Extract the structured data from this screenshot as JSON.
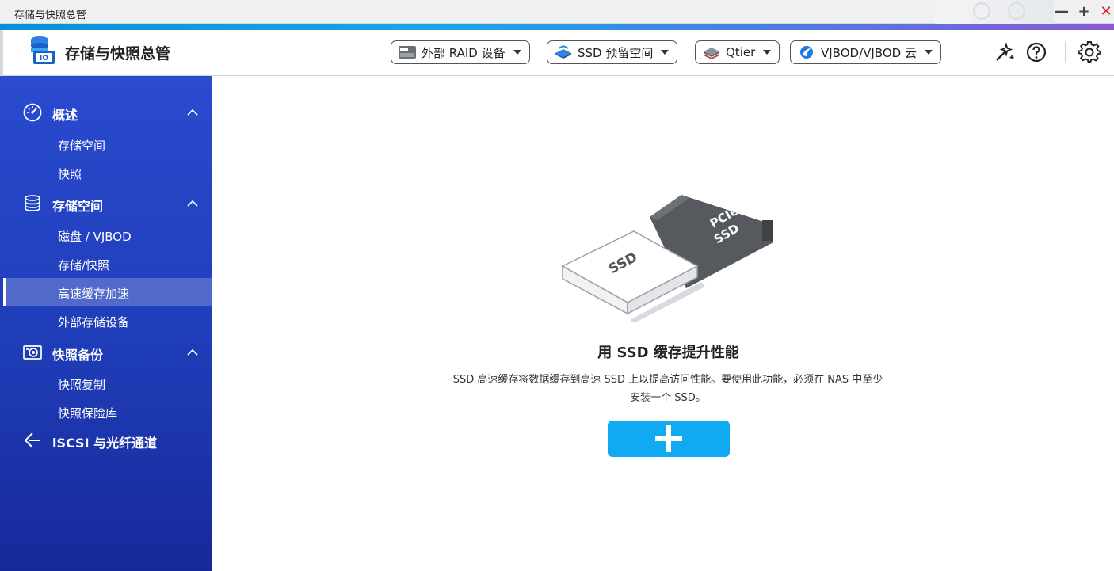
{
  "window": {
    "title": "存储与快照总管"
  },
  "header": {
    "app_title": "存储与快照总管",
    "buttons": [
      {
        "label": "外部 RAID 设备",
        "icon": "raid-device-icon"
      },
      {
        "label": "SSD 预留空间",
        "icon": "ssd-overprovision-icon"
      },
      {
        "label": "Qtier",
        "icon": "qtier-icon"
      },
      {
        "label": "VJBOD/VJBOD 云",
        "icon": "vjbod-cloud-icon"
      }
    ],
    "tools": [
      "wand-icon",
      "help-icon",
      "settings-icon"
    ]
  },
  "sidebar": {
    "sections": [
      {
        "label": "概述",
        "icon": "dashboard-gauge-icon",
        "items": [
          "存储空间",
          "快照"
        ]
      },
      {
        "label": "存储空间",
        "icon": "database-icon",
        "items": [
          "磁盘 / VJBOD",
          "存储/快照",
          "高速缓存加速",
          "外部存储设备"
        ]
      },
      {
        "label": "快照备份",
        "icon": "snapshot-backup-icon",
        "items": [
          "快照复制",
          "快照保险库"
        ]
      },
      {
        "label": "iSCSI 与光纤通道",
        "icon": "iscsi-icon",
        "items": []
      }
    ],
    "active_item": "高速缓存加速"
  },
  "main": {
    "illustration": {
      "ssd_label": "SSD",
      "pcie_label": "PCIe",
      "pcie_sub": "SSD"
    },
    "title": "用 SSD 缓存提升性能",
    "desc_line1": "SSD 高速缓存将数据缓存到高速 SSD 上以提高访问性能。要使用此功能，必须在 NAS 中至少",
    "desc_line2": "安装一个 SSD。",
    "add_button_icon": "plus-icon"
  },
  "colors": {
    "sidebar": "#2a4bd0",
    "accent": "#10aaf2",
    "close": "#e02020"
  }
}
